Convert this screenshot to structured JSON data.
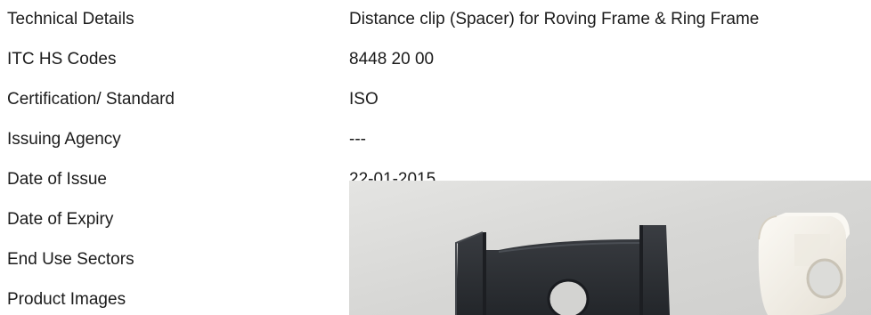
{
  "details": {
    "rows": [
      {
        "label": "Technical Details",
        "value": "Distance clip (Spacer) for Roving Frame & Ring Frame"
      },
      {
        "label": "ITC HS Codes",
        "value": "8448 20 00"
      },
      {
        "label": "Certification/ Standard",
        "value": "ISO"
      },
      {
        "label": "Issuing Agency",
        "value": "---"
      },
      {
        "label": "Date of Issue",
        "value": "22-01-2015"
      },
      {
        "label": "Date of Expiry",
        "value": ""
      },
      {
        "label": "End Use Sectors",
        "value": ""
      },
      {
        "label": "Product Images",
        "value": ""
      }
    ]
  },
  "colors": {
    "text": "#1b1b1b",
    "photo_background": "#dcdcdc",
    "clip_dark": "#2b2e33",
    "clip_light": "#f4f1ea"
  },
  "product_image": {
    "icon": "distance-clip-photo"
  }
}
